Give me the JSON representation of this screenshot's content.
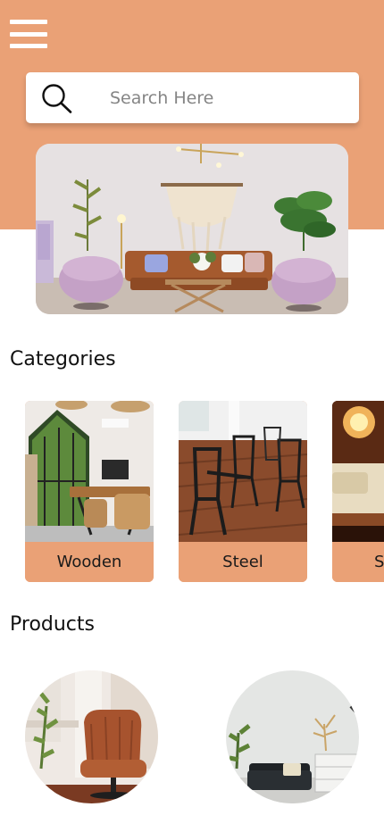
{
  "header": {
    "menu_icon": "hamburger-menu-icon",
    "accent_color": "#EAA176"
  },
  "search": {
    "placeholder": "Search Here",
    "icon": "search-icon"
  },
  "categories": {
    "title": "Categories",
    "items": [
      {
        "label": "Wooden"
      },
      {
        "label": "Steel"
      },
      {
        "label": "S"
      }
    ]
  },
  "products": {
    "title": "Products"
  }
}
